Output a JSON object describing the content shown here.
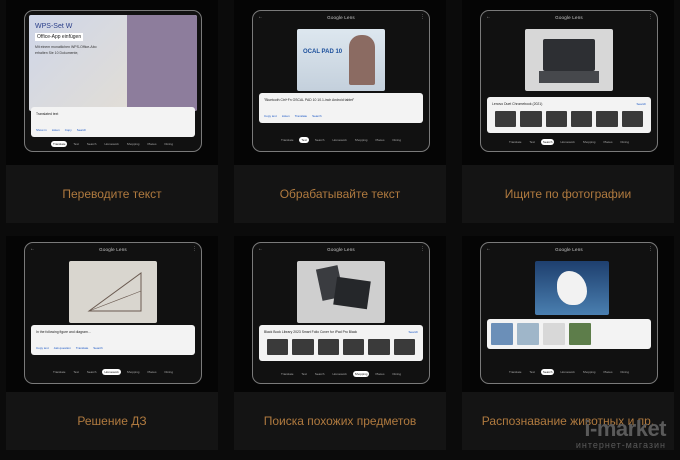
{
  "app": {
    "lens_title": "Google Lens"
  },
  "modes": [
    "Translate",
    "Text",
    "Search",
    "Homework",
    "Shopping",
    "Places",
    "Dining"
  ],
  "panels": [
    {
      "label": "Переводите текст",
      "viewport_text": [
        "WPS-Set W",
        "Office-App einfügen",
        "Mit einem monatlichen WPS-Office-Abo",
        "erhalten Sie 10 Dokumente,"
      ],
      "sheet_line": "Translated text",
      "actions": [
        "Show in",
        "Listen",
        "Copy",
        "Search"
      ],
      "active_mode": "Translate"
    },
    {
      "label": "Обрабатывайте текст",
      "viewport_text": [
        "OCAL PAD 10"
      ],
      "sheet_line": "\"Bluetooth Ctrl+Fn OSCAL PAD 10 10.1-inch Android tablet\"",
      "actions": [
        "Copy text",
        "Listen",
        "Translate",
        "Search"
      ],
      "active_mode": "Text"
    },
    {
      "label": "Ищите по фотографии",
      "viewport_text": [],
      "sheet_line": "Lenovo Duet Chromebook (2021)",
      "actions": [
        "Search"
      ],
      "active_mode": "Search"
    },
    {
      "label": "Решение ДЗ",
      "viewport_text": [],
      "sheet_line": "In the following figure and diagram...",
      "actions": [
        "Copy text",
        "Ask question",
        "Translate",
        "Search"
      ],
      "active_mode": "Homework"
    },
    {
      "label": "Поиска похожих предметов",
      "viewport_text": [],
      "sheet_line": "Black Book Library 2023 Smart Folio Cover for iPad Pro Black",
      "actions": [
        "Search"
      ],
      "active_mode": "Shopping"
    },
    {
      "label": "Распознавание животных и пр.",
      "viewport_text": [],
      "sheet_line": "",
      "actions": [],
      "active_mode": "Search"
    }
  ],
  "watermark": {
    "brand": "i-market",
    "subtitle": "интернет-магазин"
  }
}
